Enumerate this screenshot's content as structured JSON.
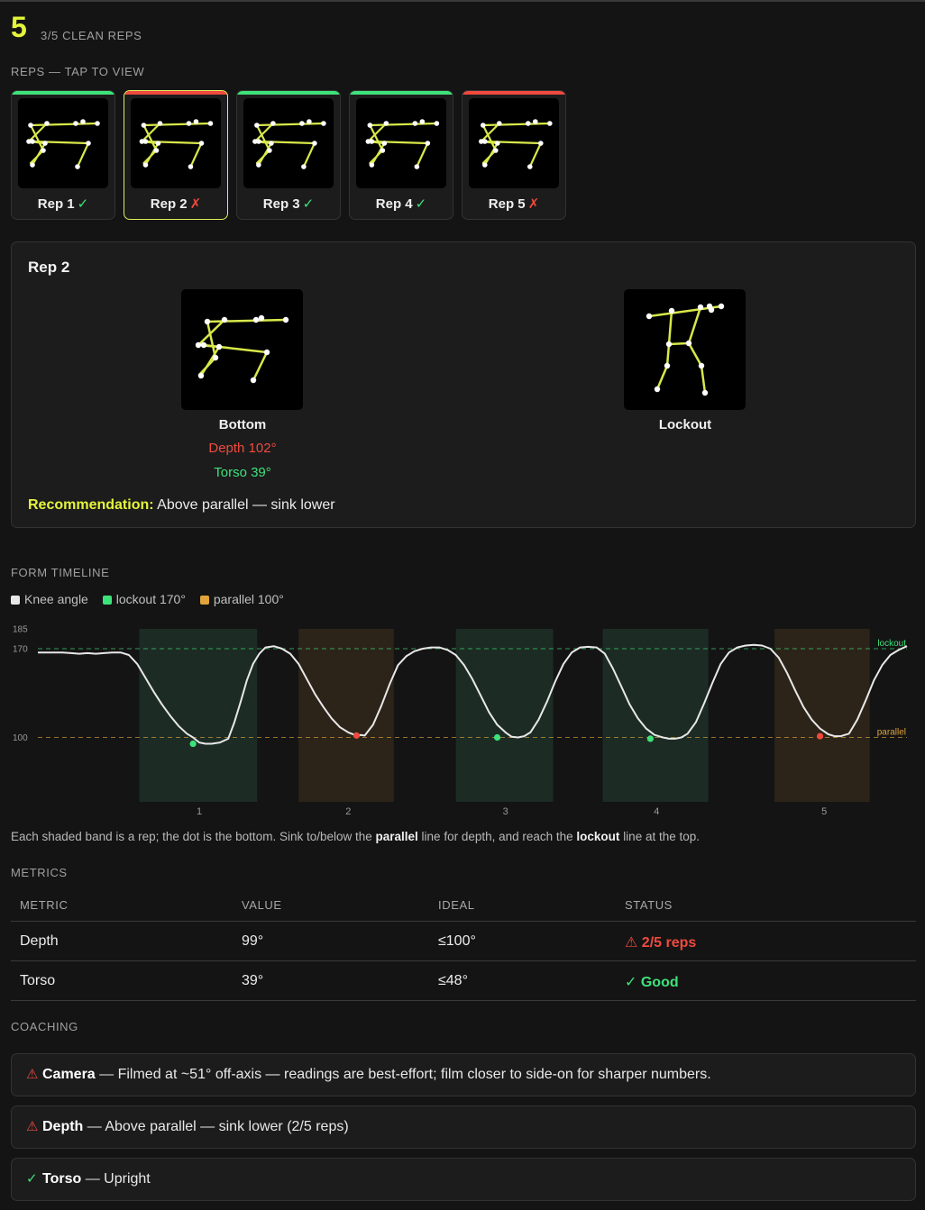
{
  "header": {
    "score": "5",
    "subtitle": "3/5 CLEAN REPS"
  },
  "reps_label": "REPS — TAP TO VIEW",
  "reps": [
    {
      "label": "Rep 1",
      "mark": "✓",
      "ok": true
    },
    {
      "label": "Rep 2",
      "mark": "✗",
      "ok": false,
      "selected": true
    },
    {
      "label": "Rep 3",
      "mark": "✓",
      "ok": true
    },
    {
      "label": "Rep 4",
      "mark": "✓",
      "ok": true
    },
    {
      "label": "Rep 5",
      "mark": "✗",
      "ok": false
    }
  ],
  "detail": {
    "title": "Rep 2",
    "bottom_caption": "Bottom",
    "depth_text": "Depth 102°",
    "torso_text": "Torso 39°",
    "lockout_caption": "Lockout",
    "recommendation_label": "Recommendation:",
    "recommendation_text": "Above parallel — sink lower"
  },
  "timeline": {
    "label": "FORM TIMELINE",
    "legend": {
      "knee": "Knee angle",
      "lockout": "lockout 170°",
      "parallel": "parallel 100°"
    },
    "note_pre": "Each shaded band is a rep; the dot is the bottom. Sink to/below the ",
    "note_b1": "parallel",
    "note_mid": " line for depth, and reach the ",
    "note_b2": "lockout",
    "note_post": " line at the top."
  },
  "chart_data": {
    "type": "line",
    "ylim": [
      80,
      185
    ],
    "yticks": [
      185,
      170,
      100
    ],
    "lockout": 170,
    "parallel": 100,
    "lockout_label": "lockout",
    "parallel_label": "parallel",
    "series": [
      {
        "values": [
          [
            0,
            167
          ],
          [
            4,
            167
          ],
          [
            8,
            167
          ],
          [
            12,
            167
          ],
          [
            16,
            166.5
          ],
          [
            20,
            166
          ],
          [
            24,
            166.5
          ],
          [
            28,
            166
          ],
          [
            32,
            166.5
          ],
          [
            36,
            167
          ],
          [
            40,
            167
          ],
          [
            44,
            165
          ],
          [
            48,
            158
          ],
          [
            52,
            147
          ],
          [
            56,
            136
          ],
          [
            60,
            126
          ],
          [
            64,
            117
          ],
          [
            68,
            109
          ],
          [
            72,
            103
          ],
          [
            75,
            100
          ],
          [
            78,
            96
          ],
          [
            81,
            95
          ],
          [
            84,
            95
          ],
          [
            88,
            96
          ],
          [
            92,
            99
          ],
          [
            95,
            112
          ],
          [
            98,
            128
          ],
          [
            101,
            145
          ],
          [
            104,
            158
          ],
          [
            107,
            166
          ],
          [
            110,
            171
          ],
          [
            114,
            172
          ],
          [
            118,
            170
          ],
          [
            122,
            166
          ],
          [
            126,
            158
          ],
          [
            130,
            146
          ],
          [
            134,
            134
          ],
          [
            138,
            124
          ],
          [
            142,
            115
          ],
          [
            146,
            108
          ],
          [
            150,
            104
          ],
          [
            154,
            101.5
          ],
          [
            156,
            102
          ],
          [
            158,
            101.5
          ],
          [
            162,
            110
          ],
          [
            166,
            125
          ],
          [
            170,
            142
          ],
          [
            174,
            157
          ],
          [
            178,
            164
          ],
          [
            182,
            168
          ],
          [
            186,
            170
          ],
          [
            190,
            171
          ],
          [
            194,
            171
          ],
          [
            198,
            169
          ],
          [
            202,
            165
          ],
          [
            206,
            157
          ],
          [
            210,
            146
          ],
          [
            214,
            133
          ],
          [
            218,
            120
          ],
          [
            222,
            110
          ],
          [
            226,
            104
          ],
          [
            229,
            100.5
          ],
          [
            232,
            100
          ],
          [
            235,
            101
          ],
          [
            238,
            104
          ],
          [
            242,
            114
          ],
          [
            246,
            128
          ],
          [
            250,
            144
          ],
          [
            254,
            158
          ],
          [
            258,
            167
          ],
          [
            262,
            171
          ],
          [
            266,
            171.5
          ],
          [
            270,
            171
          ],
          [
            274,
            166
          ],
          [
            278,
            154
          ],
          [
            282,
            140
          ],
          [
            286,
            126
          ],
          [
            290,
            115
          ],
          [
            294,
            107
          ],
          [
            298,
            102
          ],
          [
            302,
            100
          ],
          [
            305,
            99
          ],
          [
            308,
            99
          ],
          [
            311,
            100
          ],
          [
            314,
            103
          ],
          [
            318,
            112
          ],
          [
            322,
            127
          ],
          [
            326,
            143
          ],
          [
            330,
            158
          ],
          [
            334,
            167
          ],
          [
            338,
            171
          ],
          [
            342,
            172.5
          ],
          [
            346,
            173
          ],
          [
            350,
            172.5
          ],
          [
            354,
            170
          ],
          [
            358,
            163
          ],
          [
            362,
            151
          ],
          [
            366,
            137
          ],
          [
            370,
            124
          ],
          [
            374,
            114
          ],
          [
            378,
            107
          ],
          [
            382,
            102.5
          ],
          [
            385,
            101
          ],
          [
            388,
            101
          ],
          [
            392,
            103
          ],
          [
            396,
            114
          ],
          [
            400,
            129
          ],
          [
            404,
            145
          ],
          [
            408,
            157
          ],
          [
            412,
            165
          ],
          [
            416,
            169
          ],
          [
            420,
            172
          ]
        ]
      }
    ],
    "x_range": [
      0,
      420
    ],
    "rep_bands": [
      {
        "label": "1",
        "start": 49,
        "end": 106,
        "ok": true,
        "bottom": [
          75,
          95
        ],
        "tick": 78
      },
      {
        "label": "2",
        "start": 126,
        "end": 172,
        "ok": false,
        "bottom": [
          154,
          101.5
        ],
        "tick": 150
      },
      {
        "label": "3",
        "start": 202,
        "end": 249,
        "ok": true,
        "bottom": [
          222,
          100
        ],
        "tick": 226
      },
      {
        "label": "4",
        "start": 273,
        "end": 324,
        "ok": true,
        "bottom": [
          296,
          99
        ],
        "tick": 299
      },
      {
        "label": "5",
        "start": 356,
        "end": 402,
        "ok": false,
        "bottom": [
          378,
          101
        ],
        "tick": 380
      }
    ]
  },
  "metrics": {
    "label": "METRICS",
    "headers": [
      "METRIC",
      "VALUE",
      "IDEAL",
      "STATUS"
    ],
    "rows": [
      {
        "metric": "Depth",
        "value": "99°",
        "ideal": "≤100°",
        "status": "⚠ 2/5 reps",
        "ok": false
      },
      {
        "metric": "Torso",
        "value": "39°",
        "ideal": "≤48°",
        "status": "✓ Good",
        "ok": true
      }
    ]
  },
  "coaching": {
    "label": "COACHING",
    "items": [
      {
        "icon": "⚠",
        "title": "Camera",
        "text": " — Filmed at ~51° off-axis — readings are best-effort; film closer to side-on for sharper numbers.",
        "ok": false
      },
      {
        "icon": "⚠",
        "title": "Depth",
        "text": " — Above parallel — sink lower (2/5 reps)",
        "ok": false
      },
      {
        "icon": "✓",
        "title": "Torso",
        "text": " — Upright",
        "ok": true
      }
    ]
  },
  "colors": {
    "accent": "#e4f53a",
    "good": "#3ee27a",
    "bad": "#ef4a3e",
    "parallel": "#e0a43a",
    "skeleton": "#d8e84a"
  }
}
